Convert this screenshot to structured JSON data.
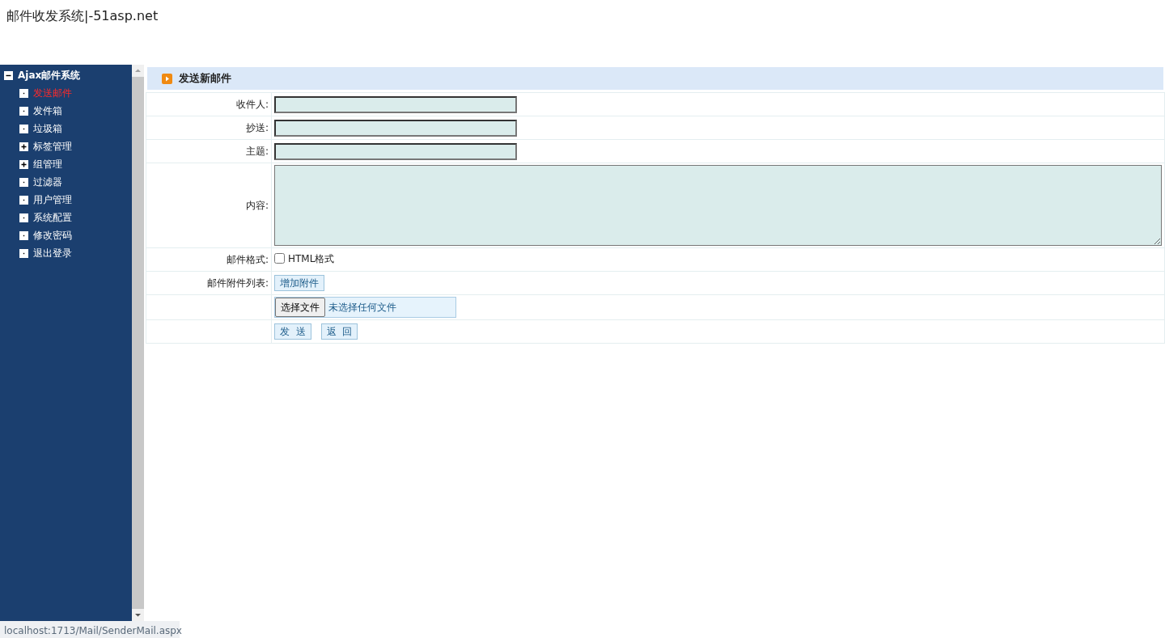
{
  "page_title": "邮件收发系统|-51asp.net",
  "sidebar": {
    "tree": [
      {
        "label": "Ajax邮件系统",
        "expanded": true,
        "children": [
          {
            "label": "发送邮件",
            "kind": "leaf",
            "selected": true
          },
          {
            "label": "发件箱",
            "kind": "leaf",
            "selected": false
          },
          {
            "label": "垃圾箱",
            "kind": "leaf",
            "selected": false
          },
          {
            "label": "标签管理",
            "kind": "folder",
            "expanded": false,
            "selected": false
          },
          {
            "label": "组管理",
            "kind": "folder",
            "expanded": false,
            "selected": false
          },
          {
            "label": "过滤器",
            "kind": "leaf",
            "selected": false
          },
          {
            "label": "用户管理",
            "kind": "leaf",
            "selected": false
          },
          {
            "label": "系统配置",
            "kind": "leaf",
            "selected": false
          },
          {
            "label": "修改密码",
            "kind": "leaf",
            "selected": false
          },
          {
            "label": "退出登录",
            "kind": "leaf",
            "selected": false
          }
        ]
      }
    ]
  },
  "panel": {
    "title": "发送新邮件",
    "rows": [
      {
        "label": "收件人:",
        "kind": "text"
      },
      {
        "label": "抄送:",
        "kind": "text"
      },
      {
        "label": "主题:",
        "kind": "text"
      },
      {
        "label": "内容:",
        "kind": "textarea"
      },
      {
        "label": "邮件格式:",
        "kind": "checkbox",
        "option": "HTML格式",
        "checked": false
      },
      {
        "label": "邮件附件列表:",
        "kind": "button",
        "button": "增加附件"
      },
      {
        "kind": "file",
        "button": "选择文件",
        "file_status": "未选择任何文件"
      },
      {
        "kind": "actions",
        "buttons": [
          "发  送",
          "返  回"
        ]
      }
    ]
  },
  "status_bar": "localhost:1713/Mail/SenderMail.aspx"
}
